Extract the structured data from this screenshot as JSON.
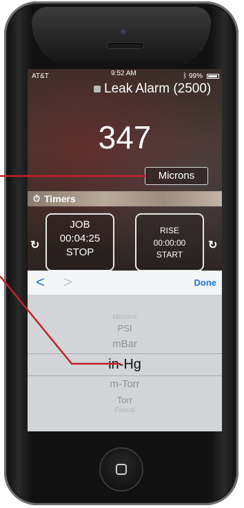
{
  "status_bar": {
    "carrier": "AT&T",
    "time": "9:52 AM",
    "battery": "99%"
  },
  "alarm": {
    "label": "Leak Alarm (2500)"
  },
  "reading": {
    "value": "347"
  },
  "unit_button": {
    "label": "Microns"
  },
  "timers": {
    "label": "Timers",
    "cards": [
      {
        "title": "JOB",
        "time": "00:04:25",
        "action": "STOP"
      },
      {
        "title": "RISE",
        "time": "00:00:00",
        "action": "START"
      }
    ]
  },
  "picker_toolbar": {
    "prev": "<",
    "next": ">",
    "done": "Done"
  },
  "picker": {
    "options": [
      "Microns",
      "PSI",
      "mBar",
      "in-Hg",
      "m-Torr",
      "Torr",
      "Pascal"
    ],
    "selected": "in-Hg"
  },
  "colors": {
    "ios_blue": "#1a73e8",
    "annotation_red": "#c4202a"
  },
  "icons": {
    "timers": "stopwatch-icon",
    "reset": "reset-icon",
    "bluetooth": "bluetooth-icon",
    "battery": "battery-icon",
    "home": "home-square-icon"
  }
}
